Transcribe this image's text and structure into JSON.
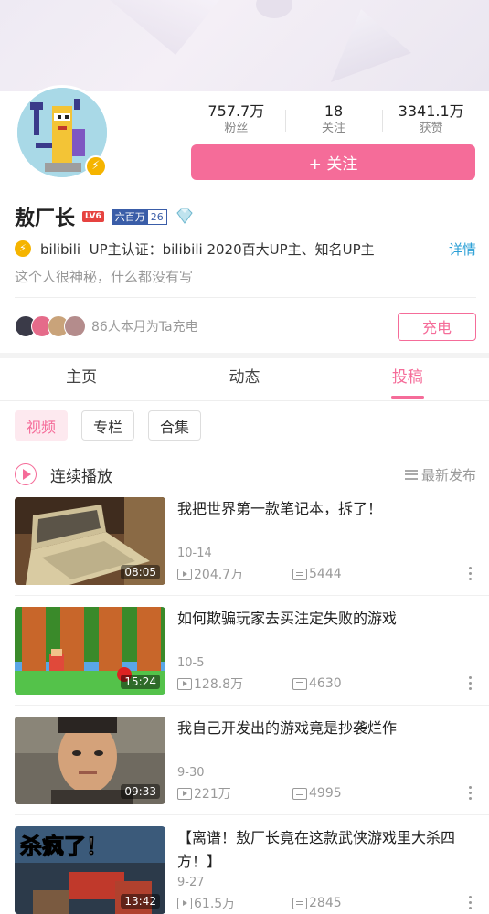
{
  "profile": {
    "stats": [
      {
        "value": "757.7万",
        "label": "粉丝"
      },
      {
        "value": "18",
        "label": "关注"
      },
      {
        "value": "3341.1万",
        "label": "获赞"
      }
    ],
    "follow_label": "+ 关注",
    "username": "敖厂长",
    "level": "LV6",
    "medal": {
      "name": "六百万",
      "level": "26"
    },
    "cert": {
      "brand": "bilibili",
      "text": "UP主认证：bilibili  2020百大UP主、知名UP主",
      "more": "详情"
    },
    "bio": "这个人很神秘，什么都没有写",
    "charge": {
      "text": "86人本月为Ta充电",
      "button": "充电"
    }
  },
  "tabs": [
    {
      "label": "主页",
      "active": false
    },
    {
      "label": "动态",
      "active": false
    },
    {
      "label": "投稿",
      "active": true
    }
  ],
  "chips": [
    {
      "label": "视频",
      "active": true
    },
    {
      "label": "专栏",
      "active": false
    },
    {
      "label": "合集",
      "active": false
    }
  ],
  "playall": {
    "label": "连续播放",
    "sort_label": "最新发布"
  },
  "videos": [
    {
      "title": "我把世界第一款笔记本，拆了！",
      "duration": "08:05",
      "date": "10-14",
      "plays": "204.7万",
      "danmaku": "5444"
    },
    {
      "title": "如何欺骗玩家去买注定失败的游戏",
      "duration": "15:24",
      "date": "10-5",
      "plays": "128.8万",
      "danmaku": "4630"
    },
    {
      "title": "我自己开发出的游戏竟是抄袭烂作",
      "duration": "09:33",
      "date": "9-30",
      "plays": "221万",
      "danmaku": "4995"
    },
    {
      "title": "【离谱！敖厂长竟在这款武侠游戏里大杀四方！】",
      "duration": "13:42",
      "date": "9-27",
      "plays": "61.5万",
      "danmaku": "2845",
      "thumb_text": "杀疯了！"
    }
  ],
  "colors": {
    "accent": "#f56c99",
    "link": "#2a9fd6",
    "level": "#e64340"
  }
}
